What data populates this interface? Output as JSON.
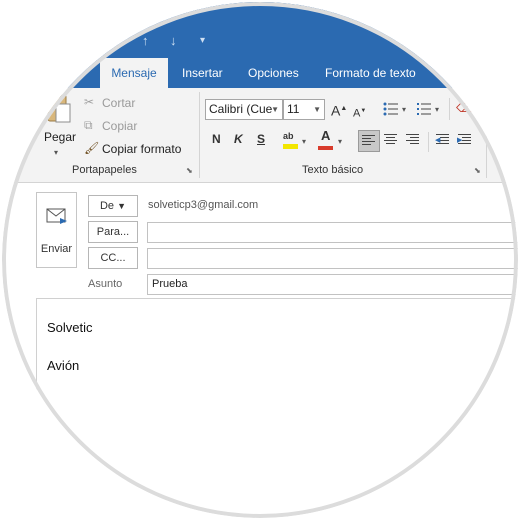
{
  "quick_access": {
    "up_icon": "↑",
    "down_icon": "↓",
    "more_icon": "▾"
  },
  "tabs": [
    {
      "label": "Mensaje",
      "active": true
    },
    {
      "label": "Insertar"
    },
    {
      "label": "Opciones"
    },
    {
      "label": "Formato de texto"
    }
  ],
  "ribbon": {
    "clipboard": {
      "paste_label": "Pegar",
      "cut_label": "Cortar",
      "copy_label": "Copiar",
      "format_painter_label": "Copiar formato",
      "group_label": "Portapapeles"
    },
    "basic_text": {
      "font_name": "Calibri (Cue",
      "font_size": "11",
      "bold_label": "N",
      "italic_label": "K",
      "underline_label": "S",
      "grow_font": "A",
      "shrink_font": "A",
      "highlight_label": "ab",
      "font_color_label": "A",
      "group_label": "Texto básico",
      "highlight_color": "#f2e600",
      "font_color": "#d83b2c"
    }
  },
  "header": {
    "send_label": "Enviar",
    "from_label": "De",
    "from_value": "solveticp3@gmail.com",
    "to_label": "Para...",
    "to_value": "",
    "cc_label": "CC...",
    "cc_value": "",
    "subject_label": "Asunto",
    "subject_value": "Prueba"
  },
  "body": {
    "lines": [
      "Solvetic",
      "Avión"
    ]
  },
  "colors": {
    "accent": "#2b6ab1",
    "ribbon_bg": "#f3f3f3"
  }
}
